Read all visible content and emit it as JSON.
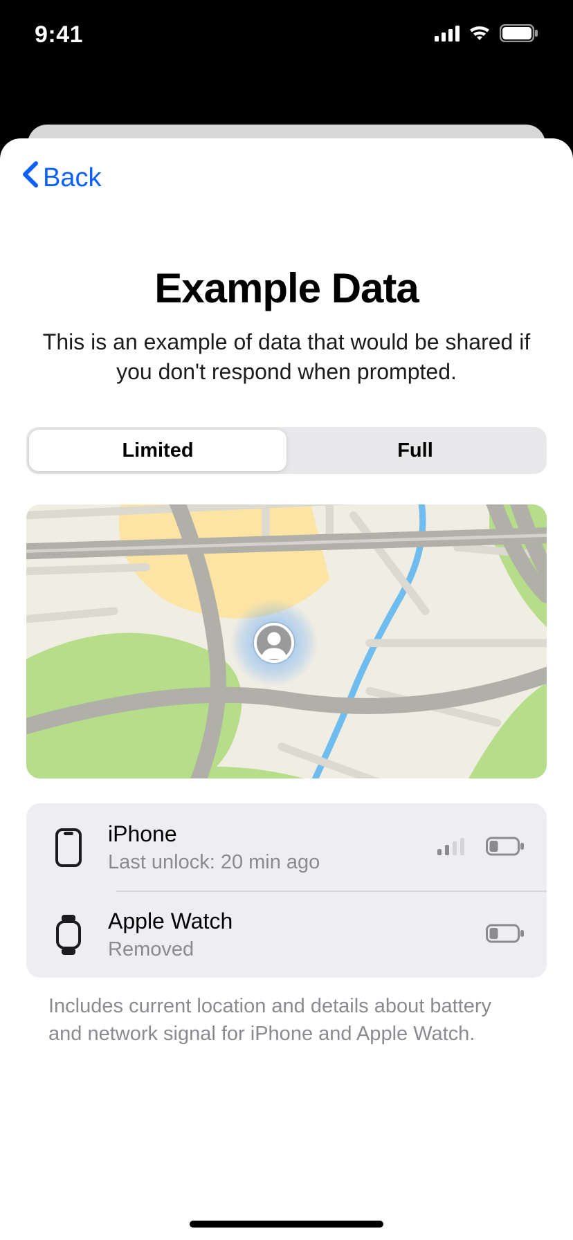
{
  "status": {
    "time": "9:41"
  },
  "nav": {
    "back_label": "Back"
  },
  "header": {
    "title": "Example Data",
    "subtitle": "This is an example of data that would be shared if you don't respond when prompted."
  },
  "segmented": {
    "options": [
      "Limited",
      "Full"
    ],
    "selected": "Limited"
  },
  "devices": [
    {
      "name": "iPhone",
      "sub": "Last unlock: 20 min ago",
      "signal": true
    },
    {
      "name": "Apple Watch",
      "sub": "Removed",
      "signal": false
    }
  ],
  "footer_note": "Includes current location and details about battery and network signal for iPhone and Apple Watch."
}
